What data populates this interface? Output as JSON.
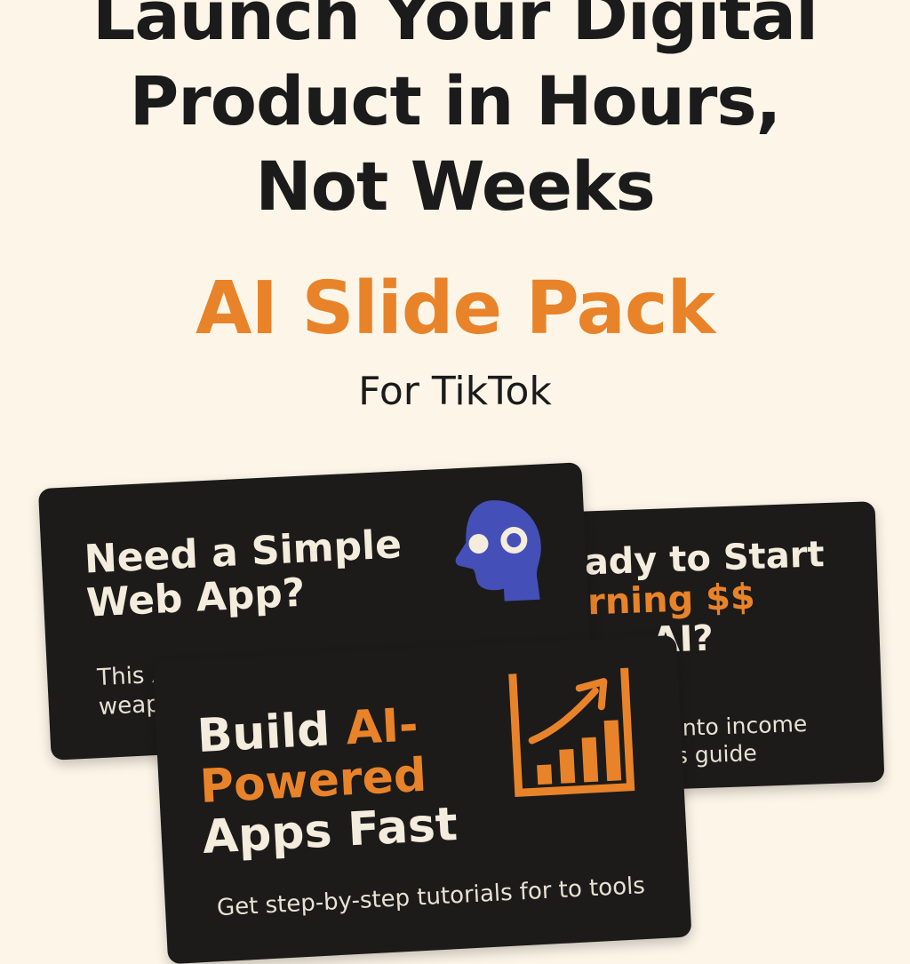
{
  "hero": {
    "headline_lines": [
      "Launch Your Digital",
      "Product in Hours,",
      "Not Weeks"
    ],
    "product_title": "AI Slide Pack",
    "product_subtitle": "For TikTok"
  },
  "cards": {
    "right": {
      "title_line1": "eady to Start",
      "title_line2_accent": "arning $$",
      "title_line3": "AI?",
      "body_line1": "eas into income",
      "body_line2": "this guide"
    },
    "left": {
      "title_line1": "Need a Simple",
      "title_line2": "Web App?",
      "body_line1": "This AI tool is your secret",
      "body_line2": "weap",
      "icon": "ai-head-icon"
    },
    "front": {
      "title_word1": "Build ",
      "title_accent_line1": "AI-",
      "title_accent_line2": "Powered",
      "title_line3": "Apps Fast",
      "body": "Get step-by-step tutorials for to tools",
      "icon": "growth-chart-icon"
    }
  },
  "colors": {
    "background": "#fdf6e8",
    "accent": "#e8832a",
    "card": "#1c1b1a",
    "text_dark": "#1b1b1b",
    "head_icon": "#4450b8"
  }
}
